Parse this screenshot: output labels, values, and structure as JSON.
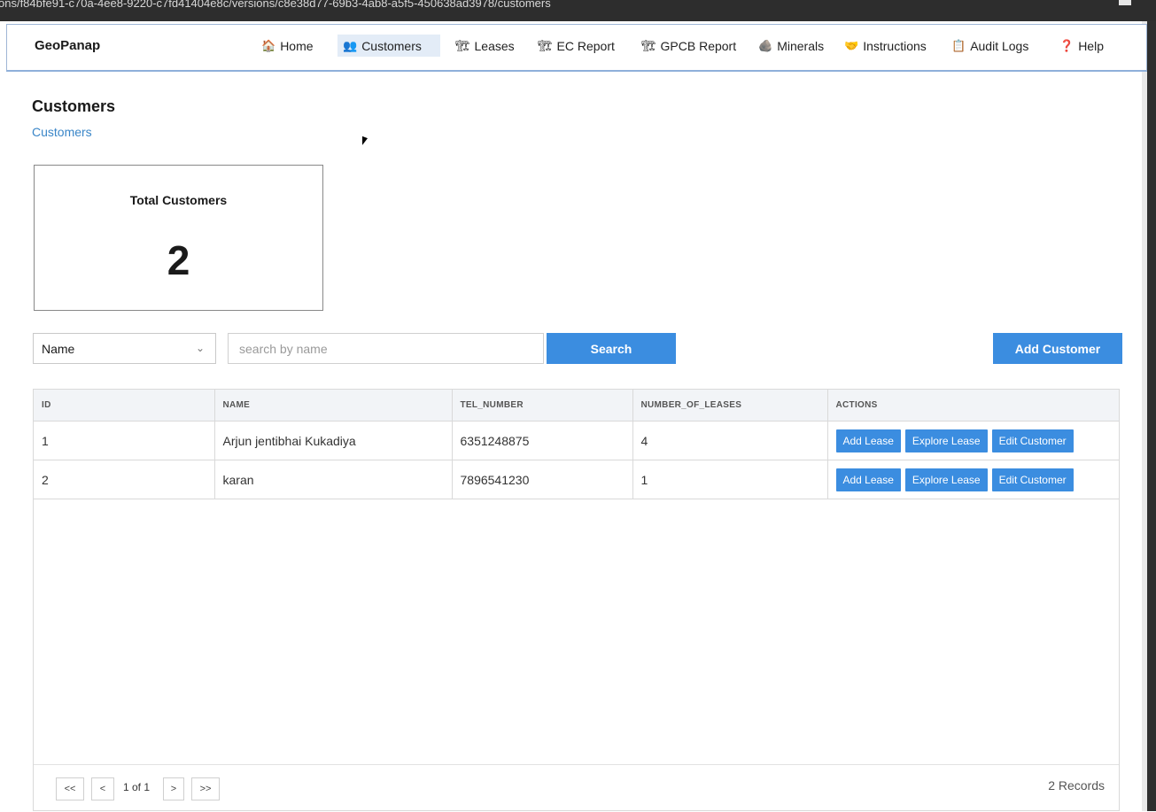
{
  "browser": {
    "url": "ons/f84bfe91-c70a-4ee8-9220-c7fd41404e8c/versions/c8e38d77-69b3-4ab8-a5f5-450638ad3978/customers"
  },
  "navbar": {
    "brand": "GeoPanap",
    "items": [
      {
        "label": "Home",
        "icon": "🏠"
      },
      {
        "label": "Customers",
        "icon": "👥"
      },
      {
        "label": "Leases",
        "icon": "🏗"
      },
      {
        "label": "EC Report",
        "icon": "🏗"
      },
      {
        "label": "GPCB Report",
        "icon": "🏗"
      },
      {
        "label": "Minerals",
        "icon": "🪨"
      },
      {
        "label": "Instructions",
        "icon": "🤝"
      },
      {
        "label": "Audit Logs",
        "icon": "📋"
      },
      {
        "label": "Help",
        "icon": "❓"
      }
    ],
    "active": "Customers"
  },
  "page": {
    "title": "Customers",
    "breadcrumb": "Customers"
  },
  "summary": {
    "label": "Total Customers",
    "value": "2"
  },
  "filters": {
    "field_selected": "Name",
    "search_placeholder": "search by name",
    "search_value": "",
    "search_label": "Search",
    "add_label": "Add Customer"
  },
  "table": {
    "columns": [
      "ID",
      "NAME",
      "TEL_NUMBER",
      "NUMBER_OF_LEASES",
      "ACTIONS"
    ],
    "rows": [
      {
        "id": "1",
        "name": "Arjun jentibhai Kukadiya",
        "tel": "6351248875",
        "leases": "4"
      },
      {
        "id": "2",
        "name": "karan",
        "tel": "7896541230",
        "leases": "1"
      }
    ],
    "actions": {
      "add_lease": "Add Lease",
      "explore_lease": "Explore Lease",
      "edit_customer": "Edit Customer"
    }
  },
  "pagination": {
    "first": "<<",
    "prev": "<",
    "info": "1 of 1",
    "next": ">",
    "last": ">>",
    "records": "2 Records"
  },
  "colors": {
    "accent": "#3b8de0",
    "link": "#3a86c8",
    "nav_active_bg": "#e3ecf7"
  }
}
